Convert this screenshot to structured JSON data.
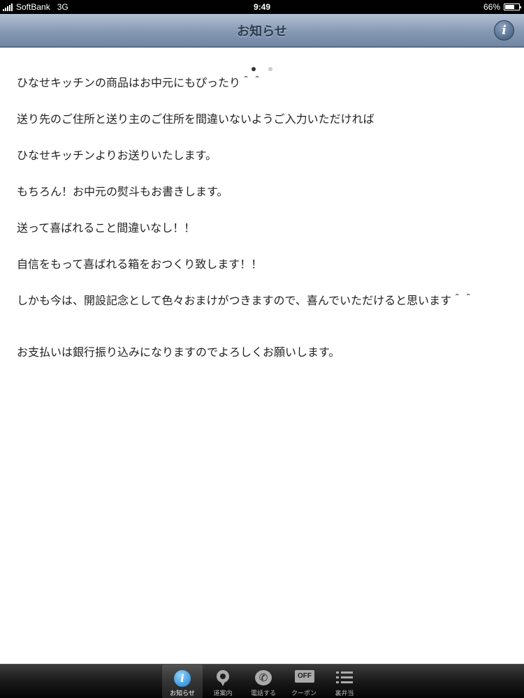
{
  "status_bar": {
    "carrier": "SoftBank",
    "network": "3G",
    "time": "9:49",
    "battery_percent": "66%",
    "battery_level": 0.66
  },
  "nav": {
    "title": "お知らせ",
    "info_icon": "info-icon"
  },
  "pagination": {
    "total": 2,
    "current": 1
  },
  "content": {
    "paragraphs": [
      "ひなせキッチンの商品はお中元にもぴったり＾＾",
      "送り先のご住所と送り主のご住所を間違いないようご入力いただければ",
      "ひなせキッチンよりお送りいたします。",
      "もちろん！お中元の熨斗もお書きします。",
      "送って喜ばれること間違いなし！！",
      "自信をもって喜ばれる箱をおつくり致します！！",
      "しかも今は、開設記念として色々おまけがつきますので、喜んでいただけると思います＾＾",
      "お支払いは銀行振り込みになりますのでよろしくお願いします。"
    ]
  },
  "tab_bar": {
    "items": [
      {
        "label": "お知らせ",
        "icon": "info-icon",
        "selected": true
      },
      {
        "label": "道案内",
        "icon": "map-pin-icon",
        "selected": false
      },
      {
        "label": "電話する",
        "icon": "phone-icon",
        "selected": false
      },
      {
        "label": "クーポン",
        "icon": "coupon-icon",
        "selected": false,
        "icon_text": "OFF"
      },
      {
        "label": "裏弁当",
        "icon": "list-icon",
        "selected": false
      }
    ]
  }
}
